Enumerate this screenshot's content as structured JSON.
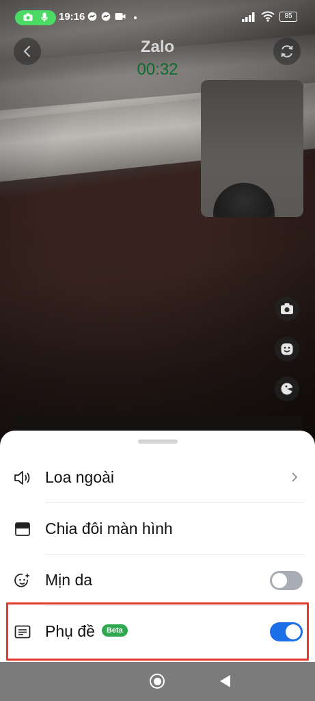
{
  "status_bar": {
    "time": "19:16",
    "battery": "85",
    "icons": [
      "camera-icon",
      "mic-icon",
      "messenger-icon",
      "video-icon",
      "dot-icon",
      "signal-icon",
      "wifi-icon",
      "battery-icon"
    ]
  },
  "call": {
    "app_name": "Zalo",
    "timer": "00:32"
  },
  "menu": {
    "items": [
      {
        "label": "Loa ngoài",
        "icon": "speaker-icon",
        "control": "chevron"
      },
      {
        "label": "Chia đôi màn hình",
        "icon": "split-screen-icon",
        "control": "none"
      },
      {
        "label": "Mịn da",
        "icon": "beauty-face-icon",
        "control": "toggle",
        "enabled": false
      },
      {
        "label": "Phụ đề",
        "icon": "subtitles-icon",
        "badge": "Beta",
        "control": "toggle",
        "enabled": true
      }
    ]
  },
  "colors": {
    "toggle_on": "#1d6fe8",
    "toggle_off": "#a8adb3",
    "badge": "#2fa84f",
    "highlight": "#e53a2a",
    "timer": "#0d6b2e"
  }
}
